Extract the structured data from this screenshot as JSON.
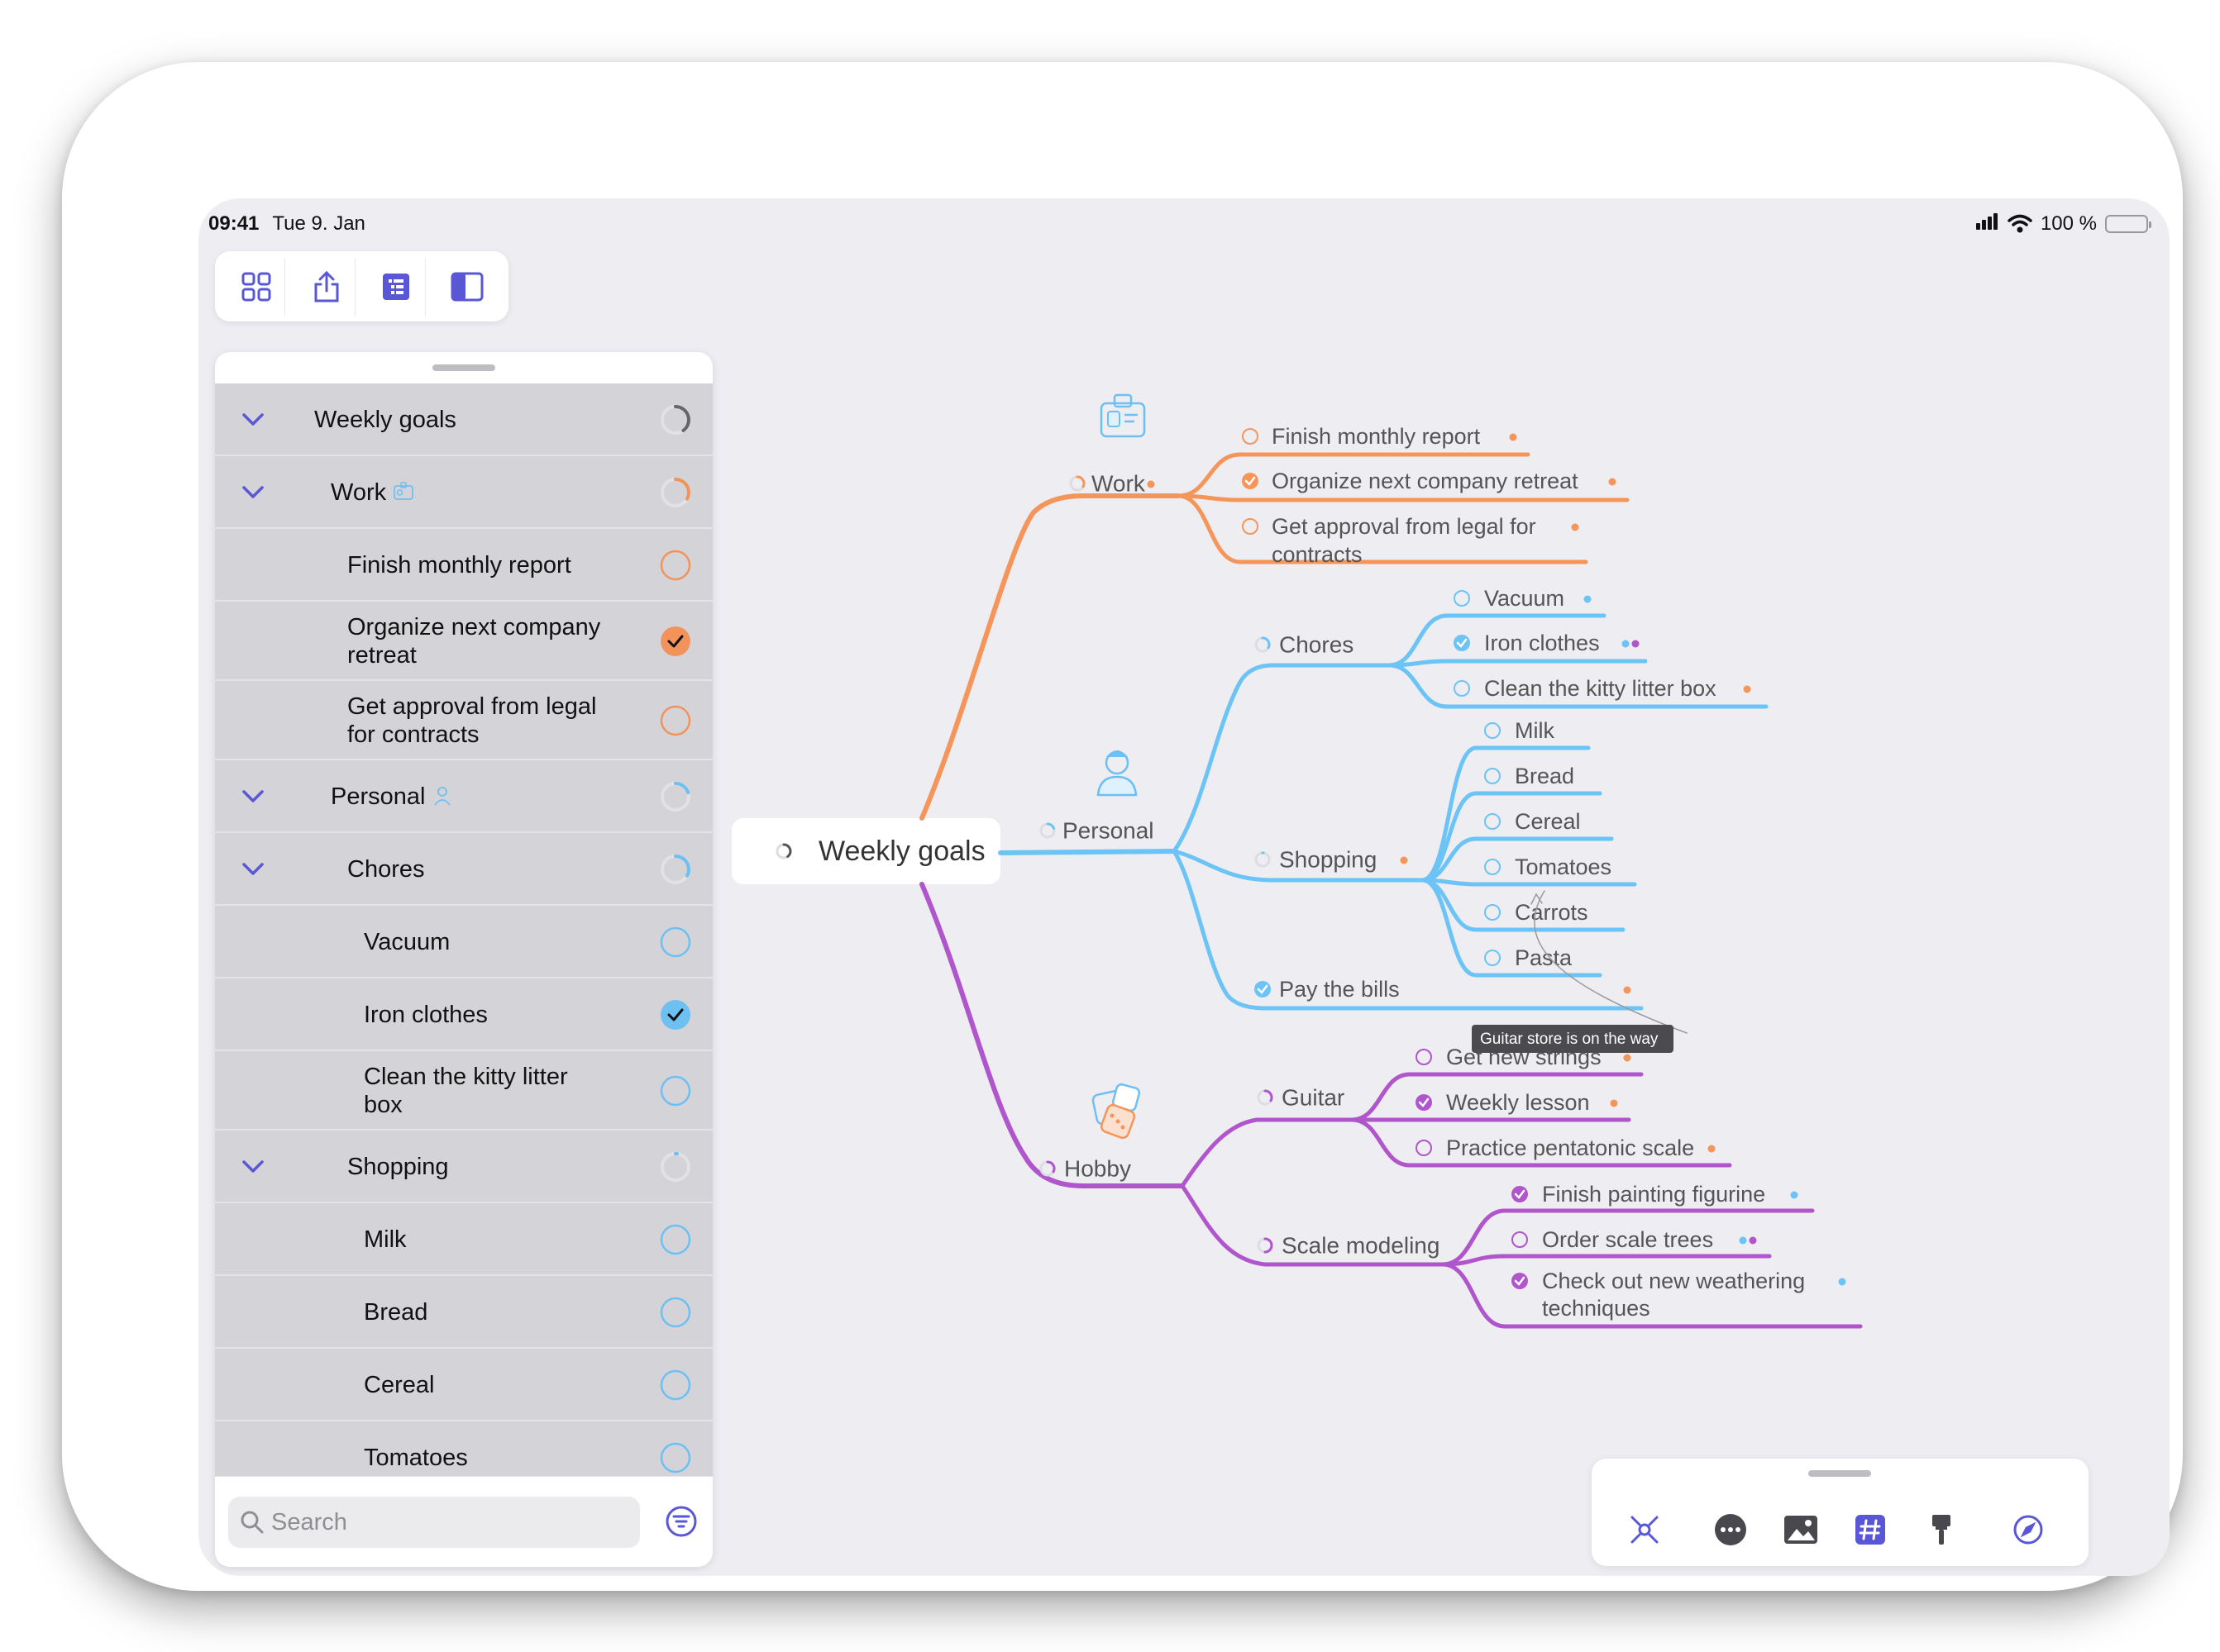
{
  "status_bar": {
    "time": "09:41",
    "date": "Tue 9. Jan",
    "battery": "100 %"
  },
  "top_toolbar": {
    "icons": [
      "grid-icon",
      "share-icon",
      "outline-list-icon",
      "sidebar-icon"
    ]
  },
  "outline": {
    "rows": [
      {
        "label": "Weekly goals",
        "badge": "",
        "level": 0,
        "chevron": true,
        "status": "progress",
        "color": "#666666",
        "progress": 0.4
      },
      {
        "label": "Work",
        "badge": "id-card-icon",
        "level": 1,
        "chevron": true,
        "status": "progress",
        "color": "#f2935c",
        "progress": 0.33
      },
      {
        "label": "Finish monthly report",
        "badge": "",
        "level": 2,
        "chevron": false,
        "status": "open",
        "color": "#f2935c"
      },
      {
        "label": "Organize next company retreat",
        "badge": "",
        "level": 2,
        "chevron": false,
        "status": "done",
        "color": "#f2935c"
      },
      {
        "label": "Get approval from legal for contracts",
        "badge": "",
        "level": 2,
        "chevron": false,
        "status": "open",
        "color": "#f2935c"
      },
      {
        "label": "Personal",
        "badge": "person-icon",
        "level": 1,
        "chevron": true,
        "status": "progress",
        "color": "#6cc0f2",
        "progress": 0.2
      },
      {
        "label": "Chores",
        "badge": "",
        "level": 2,
        "chevron": true,
        "status": "progress",
        "color": "#6cc0f2",
        "progress": 0.33
      },
      {
        "label": "Vacuum",
        "badge": "",
        "level": 3,
        "chevron": false,
        "status": "open",
        "color": "#6cc0f2"
      },
      {
        "label": "Iron clothes",
        "badge": "",
        "level": 3,
        "chevron": false,
        "status": "done",
        "color": "#6cc0f2"
      },
      {
        "label": "Clean the kitty litter box",
        "badge": "",
        "level": 3,
        "chevron": false,
        "status": "open",
        "color": "#6cc0f2"
      },
      {
        "label": "Shopping",
        "badge": "",
        "level": 2,
        "chevron": true,
        "status": "progress",
        "color": "#6cc0f2",
        "progress": 0.0
      },
      {
        "label": "Milk",
        "badge": "",
        "level": 3,
        "chevron": false,
        "status": "open",
        "color": "#6cc0f2"
      },
      {
        "label": "Bread",
        "badge": "",
        "level": 3,
        "chevron": false,
        "status": "open",
        "color": "#6cc0f2"
      },
      {
        "label": "Cereal",
        "badge": "",
        "level": 3,
        "chevron": false,
        "status": "open",
        "color": "#6cc0f2"
      },
      {
        "label": "Tomatoes",
        "badge": "",
        "level": 3,
        "chevron": false,
        "status": "open",
        "color": "#6cc0f2"
      }
    ],
    "search_placeholder": "Search"
  },
  "mindmap": {
    "root": "Weekly goals",
    "colors": {
      "work": "#f5955a",
      "personal": "#6cc3f5",
      "hobby": "#b055cc",
      "text": "#555555"
    },
    "branches": {
      "work": {
        "label": "Work",
        "items": [
          "Finish monthly report",
          "Organize next company retreat",
          "Get approval from legal for",
          "contracts"
        ]
      },
      "personal": {
        "label": "Personal",
        "chores": {
          "label": "Chores",
          "items": [
            "Vacuum",
            "Iron clothes",
            "Clean the kitty litter box"
          ]
        },
        "shopping": {
          "label": "Shopping",
          "items": [
            "Milk",
            "Bread",
            "Cereal",
            "Tomatoes",
            "Carrots",
            "Pasta"
          ]
        },
        "bills": "Pay the bills",
        "note": "Guitar store is on the way"
      },
      "hobby": {
        "label": "Hobby",
        "guitar": {
          "label": "Guitar",
          "items": [
            "Get new strings",
            "Weekly lesson",
            "Practice pentatonic scale"
          ]
        },
        "scale": {
          "label": "Scale modeling",
          "items": [
            "Finish painting figurine",
            "Order scale trees",
            "Check out new weathering",
            "techniques"
          ]
        }
      }
    }
  },
  "bottom_toolbar": {
    "icons": [
      "focus-icon",
      "more-icon",
      "image-icon",
      "tag-icon",
      "style-brush-icon",
      "navigate-icon"
    ]
  }
}
